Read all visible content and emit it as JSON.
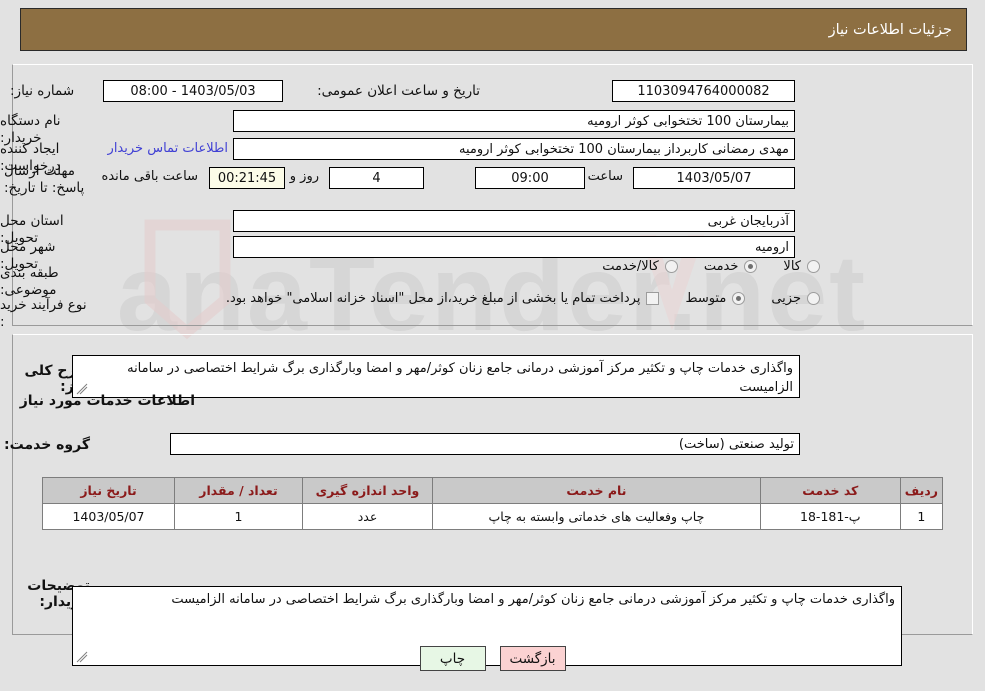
{
  "header": {
    "title": "جزئیات اطلاعات نیاز",
    "bg_color": "#8d6f42",
    "text_color": "#ffffff"
  },
  "form": {
    "need_number_label": "شماره نیاز:",
    "need_number_value": "1103094764000082",
    "public_announce_label": "تاریخ و ساعت اعلان عمومی:",
    "public_announce_value": "1403/05/03 - 08:00",
    "buyer_org_label": "نام دستگاه خریدار:",
    "buyer_org_value": "بیمارستان 100 تختخوابی کوثر ارومیه",
    "requester_label": "ایجاد کننده درخواست:",
    "requester_value": "مهدی رمضانی کاربرداز بیمارستان 100 تختخوابی کوثر ارومیه",
    "buyer_contact_link": "اطلاعات تماس خریدار",
    "deadline_label": "مهلت ارسال پاسخ: تا تاریخ:",
    "deadline_date": "1403/05/07",
    "deadline_time_label": "ساعت",
    "deadline_time": "09:00",
    "remaining_days": "4",
    "remaining_days_label": "روز و",
    "remaining_clock": "00:21:45",
    "remaining_clock_label": "ساعت باقی مانده",
    "province_label": "استان محل تحویل:",
    "province_value": "آذربایجان غربی",
    "city_label": "شهر محل تحویل:",
    "city_value": "ارومیه",
    "category_label": "طبقه بندی موضوعی:",
    "category_options": [
      {
        "label": "کالا",
        "selected": false
      },
      {
        "label": "خدمت",
        "selected": true
      },
      {
        "label": "کالا/خدمت",
        "selected": false
      }
    ],
    "process_label": "نوع فرآیند خرید :",
    "process_options": [
      {
        "label": "جزیی",
        "selected": false
      },
      {
        "label": "متوسط",
        "selected": true
      }
    ],
    "treasury_checkbox_checked": false,
    "treasury_note": "پرداخت تمام یا بخشی از مبلغ خرید،از محل \"اسناد خزانه اسلامی\" خواهد بود."
  },
  "summary": {
    "label": "شرح کلی نیاز:",
    "value": "واگذاری خدمات چاپ و تکثیر مرکز آموزشی درمانی جامع زنان کوثر/مهر و امضا وبارگذاری برگ شرایط اختصاصی در سامانه الزامیست"
  },
  "services_section": {
    "heading": "اطلاعات خدمات مورد نیاز",
    "group_label": "گروه خدمت:",
    "group_value": "تولید صنعتی (ساخت)"
  },
  "table": {
    "columns": [
      "ردیف",
      "کد خدمت",
      "نام خدمت",
      "واحد اندازه گیری",
      "تعداد / مقدار",
      "تاریخ نیاز"
    ],
    "rows": [
      {
        "row_no": "1",
        "service_code": "پ-181-18",
        "service_name": "چاپ وفعالیت های خدماتی وابسته به چاپ",
        "unit": "عدد",
        "quantity": "1",
        "need_date": "1403/05/07"
      }
    ]
  },
  "buyer_notes": {
    "label": "توضیحات خریدار:",
    "value": "واگذاری خدمات چاپ و تکثیر مرکز آموزشی درمانی جامع زنان کوثر/مهر و امضا وبارگذاری برگ شرایط اختصاصی در سامانه الزامیست"
  },
  "buttons": {
    "print": "چاپ",
    "back": "بازگشت"
  }
}
